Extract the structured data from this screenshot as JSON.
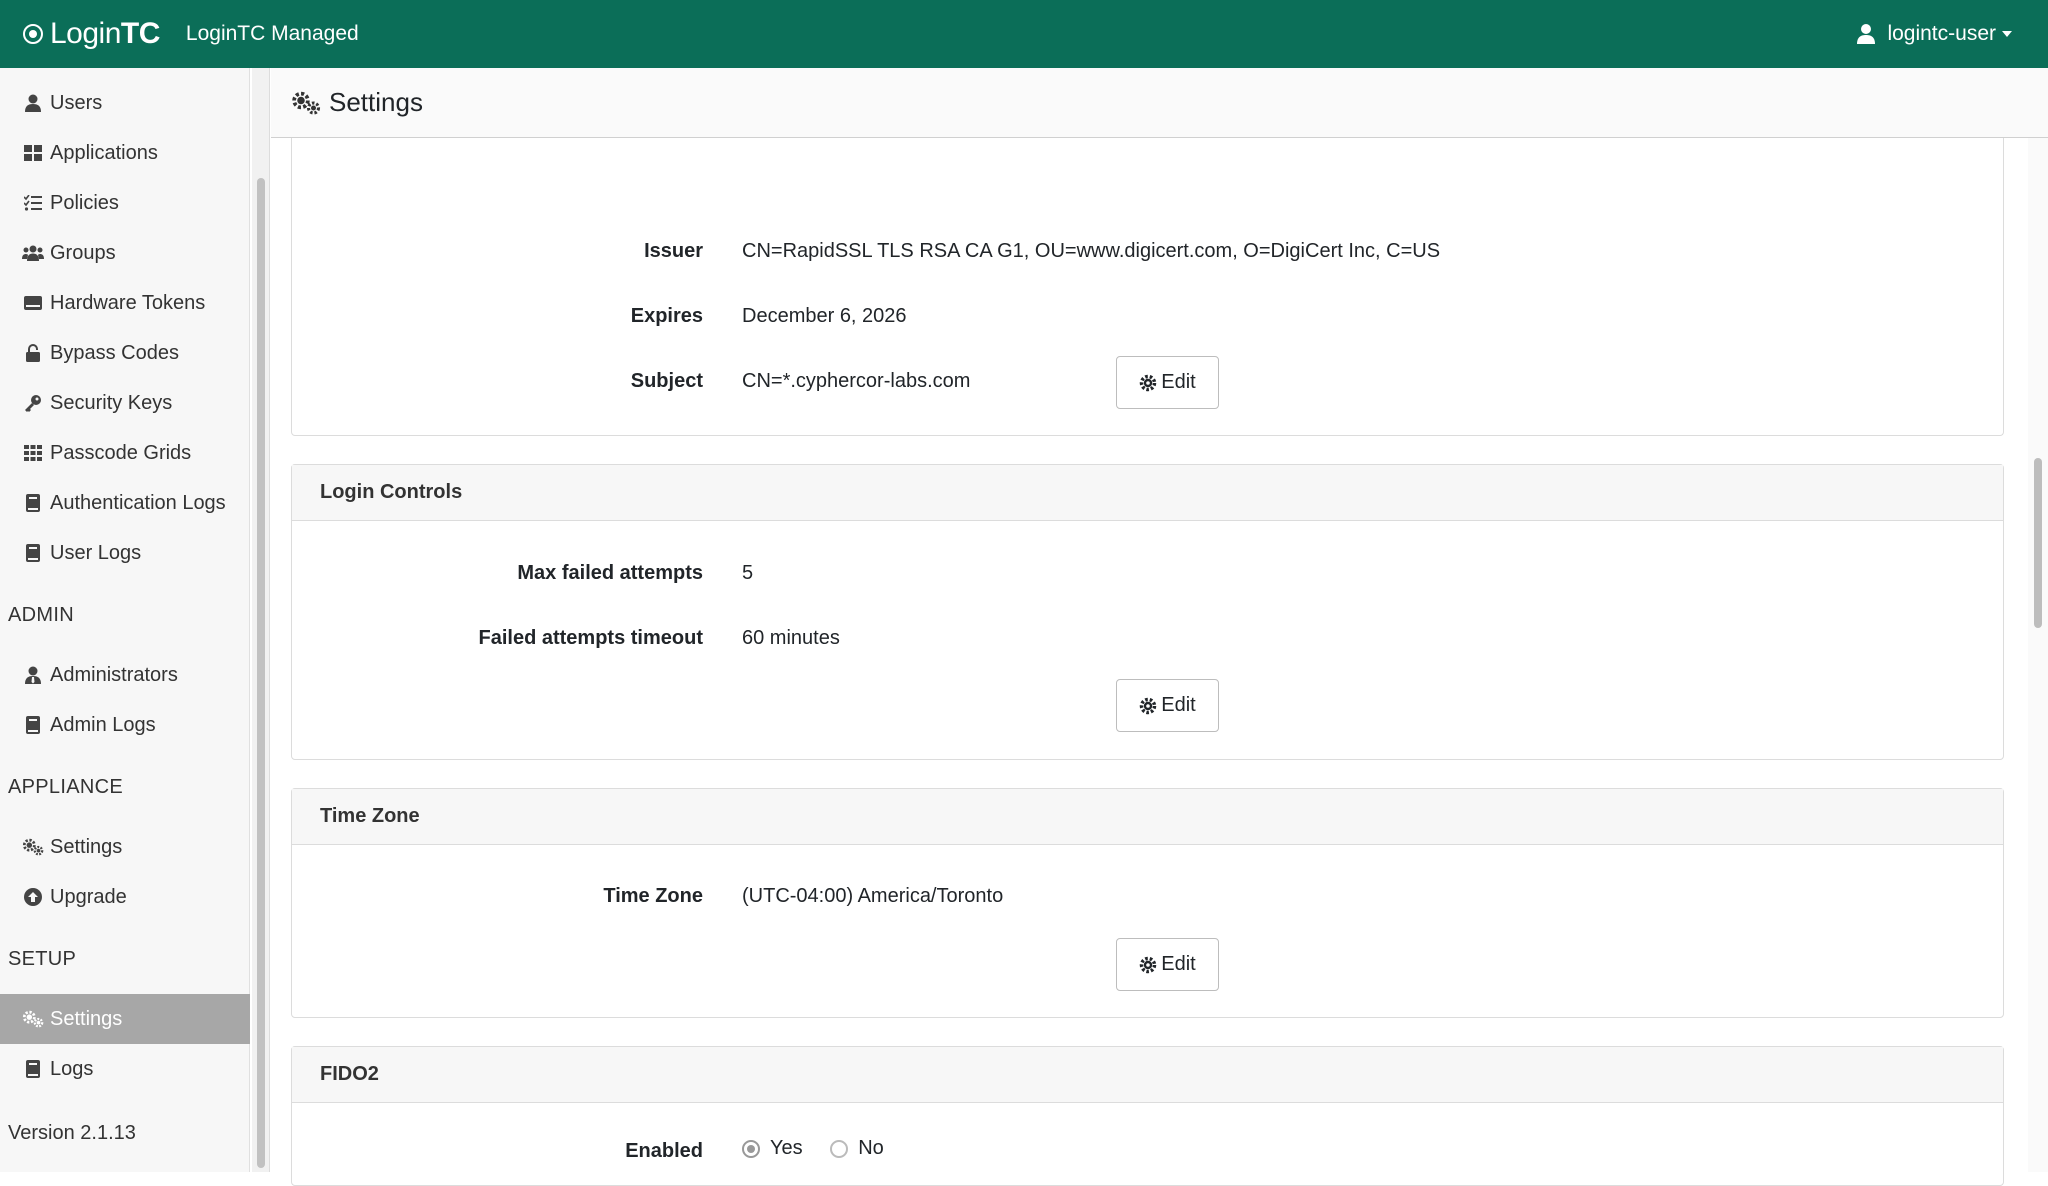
{
  "navbar": {
    "logo_login": "Login",
    "logo_tc": "TC",
    "subtitle": "LoginTC Managed",
    "user": "logintc-user"
  },
  "sidebar": {
    "items": [
      {
        "label": "Users",
        "icon": "user-icon"
      },
      {
        "label": "Applications",
        "icon": "grid-icon"
      },
      {
        "label": "Policies",
        "icon": "list-check-icon"
      },
      {
        "label": "Groups",
        "icon": "users-icon"
      },
      {
        "label": "Hardware Tokens",
        "icon": "token-icon"
      },
      {
        "label": "Bypass Codes",
        "icon": "unlock-icon"
      },
      {
        "label": "Security Keys",
        "icon": "key-icon"
      },
      {
        "label": "Passcode Grids",
        "icon": "grid-3x3-icon"
      },
      {
        "label": "Authentication Logs",
        "icon": "book-icon"
      },
      {
        "label": "User Logs",
        "icon": "book-icon"
      }
    ],
    "admin_heading": "ADMIN",
    "admin_items": [
      {
        "label": "Administrators",
        "icon": "user-tie-icon"
      },
      {
        "label": "Admin Logs",
        "icon": "book-icon"
      }
    ],
    "appliance_heading": "APPLIANCE",
    "appliance_items": [
      {
        "label": "Settings",
        "icon": "cogs-icon"
      },
      {
        "label": "Upgrade",
        "icon": "arrow-circle-up-icon"
      }
    ],
    "setup_heading": "SETUP",
    "setup_items": [
      {
        "label": "Settings",
        "icon": "cogs-icon",
        "active": true
      },
      {
        "label": "Logs",
        "icon": "book-icon"
      }
    ],
    "version": "Version 2.1.13"
  },
  "page": {
    "title": "Settings"
  },
  "certificate": {
    "issuer_label": "Issuer",
    "issuer_value": "CN=RapidSSL TLS RSA CA G1, OU=www.digicert.com, O=DigiCert Inc, C=US",
    "expires_label": "Expires",
    "expires_value": "December 6, 2026",
    "subject_label": "Subject",
    "subject_value": "CN=*.cyphercor-labs.com",
    "edit_label": "Edit"
  },
  "login_controls": {
    "title": "Login Controls",
    "max_failed_label": "Max failed attempts",
    "max_failed_value": "5",
    "timeout_label": "Failed attempts timeout",
    "timeout_value": "60 minutes",
    "edit_label": "Edit"
  },
  "time_zone": {
    "title": "Time Zone",
    "label": "Time Zone",
    "value": "(UTC-04:00) America/Toronto",
    "edit_label": "Edit"
  },
  "fido2": {
    "title": "FIDO2",
    "enabled_label": "Enabled",
    "yes_label": "Yes",
    "no_label": "No",
    "selected": "Yes"
  },
  "colors": {
    "navbar": "#0b6e58",
    "active_nav": "#a7a7a7"
  }
}
